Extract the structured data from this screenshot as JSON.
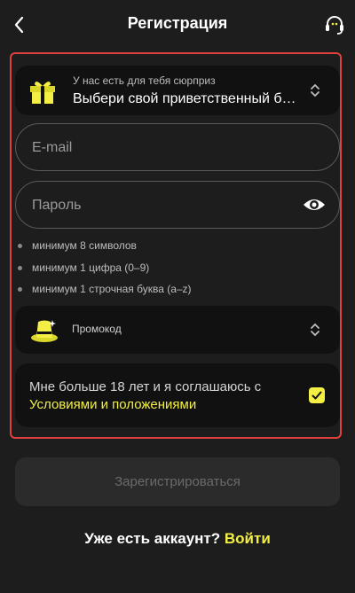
{
  "header": {
    "title": "Регистрация"
  },
  "bonus": {
    "hint": "У нас есть для тебя сюрприз",
    "value": "Выбери свой приветственный бонус"
  },
  "email": {
    "placeholder": "E-mail"
  },
  "password": {
    "placeholder": "Пароль"
  },
  "rules": [
    "минимум 8 символов",
    "минимум 1 цифра (0–9)",
    "минимум 1 строчная буква (a–z)"
  ],
  "promo": {
    "label": "Промокод"
  },
  "terms": {
    "text": "Мне больше 18 лет и я соглашаюсь с",
    "link": "Условиями и положениями",
    "checked": true
  },
  "submit": {
    "label": "Зарегистрироваться"
  },
  "login": {
    "prompt": "Уже есть аккаунт?",
    "link": "Войти"
  },
  "colors": {
    "accent": "#f3ef45",
    "highlight_border": "#e0413d",
    "background": "#1d1d1d"
  },
  "icons": [
    "chevron-left-icon",
    "headset-icon",
    "gift-icon",
    "updown-chevron-icon",
    "eye-icon",
    "magic-hat-icon",
    "check-icon"
  ]
}
